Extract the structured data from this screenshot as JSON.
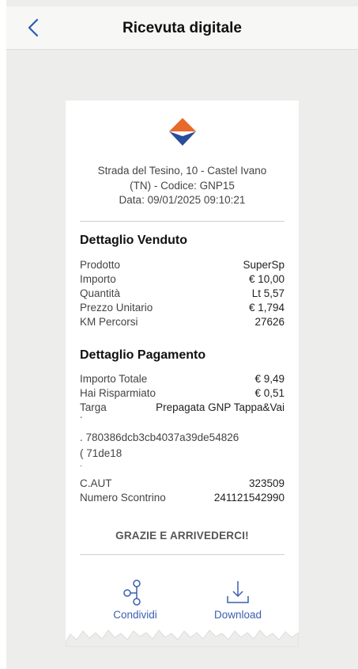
{
  "header": {
    "title": "Ricevuta digitale",
    "back_icon": "chevron-left-icon"
  },
  "receipt": {
    "address_line1": "Strada del Tesino, 10 - Castel Ivano",
    "address_line2": "(TN) - Codice: GNP15",
    "date_line": "Data: 09/01/2025 09:10:21",
    "venduto": {
      "title": "Dettaglio Venduto",
      "rows": [
        {
          "label": "Prodotto",
          "value": "SuperSp"
        },
        {
          "label": "Importo",
          "value": "€ 10,00"
        },
        {
          "label": "Quantità",
          "value": "Lt 5,57"
        },
        {
          "label": "Prezzo Unitario",
          "value": "€ 1,794"
        },
        {
          "label": "KM Percorsi",
          "value": "27626"
        }
      ]
    },
    "pagamento": {
      "title": "Dettaglio Pagamento",
      "rows": [
        {
          "label": "Importo Totale",
          "value": "€ 9,49"
        },
        {
          "label": "Hai Risparmiato",
          "value": "€ 0,51"
        },
        {
          "label": "Targa",
          "value": "Prepagata GNP Tappa&Vai"
        }
      ],
      "dash": "-",
      "code_prefix1": ".",
      "code_line1": "780386dcb3cb4037a39de54826",
      "code_prefix2": "(",
      "code_line2": "71de18",
      "dot": ".",
      "caut_label": "C.AUT",
      "caut_value": "323509",
      "scontrino_label": "Numero Scontrino",
      "scontrino_value": "241121542990"
    },
    "thanks": "GRAZIE E ARRIVEDERCI!"
  },
  "actions": {
    "share_label": "Condividi",
    "download_label": "Download"
  },
  "colors": {
    "logo_orange": "#e8692c",
    "logo_blue": "#2a4d9c",
    "accent": "#3a5fb0"
  }
}
